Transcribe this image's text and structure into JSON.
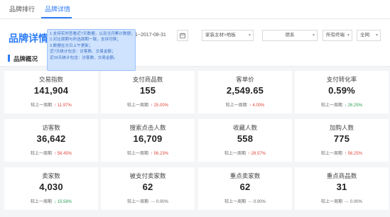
{
  "tabs": [
    {
      "label": "品牌排行"
    },
    {
      "label": "品牌详情"
    }
  ],
  "brand_title": "品牌详情",
  "tooltip_lines": [
    "1.支持实时查看近7天数据，以及当月累计数据；",
    "2.对比周期与所选周期一致，支持切换；",
    "3.数据在次日上午更新；",
    "近7天统计包含：访客数、交易金额；",
    "近30天统计包含：访客数、交易金额。"
  ],
  "filters": {
    "date_range": "1~2017-08-31",
    "category": "家装主材>地板",
    "brand": "德系",
    "terminal": "所有终端",
    "scope": "全网"
  },
  "section_title": "品牌概况",
  "compare_label": "较上一周期",
  "metrics": [
    {
      "label": "交易指数",
      "value": "141,904",
      "dir": "up",
      "change": "11.97%"
    },
    {
      "label": "支付商品数",
      "value": "155",
      "dir": "up",
      "change": "25.00%"
    },
    {
      "label": "客单价",
      "value": "2,549.65",
      "dir": "up",
      "change": "4.00%"
    },
    {
      "label": "支付转化率",
      "value": "0.59%",
      "dir": "down",
      "change": "26.25%"
    },
    {
      "label": "访客数",
      "value": "36,642",
      "dir": "up",
      "change": "58.45%"
    },
    {
      "label": "搜索点击人数",
      "value": "16,709",
      "dir": "up",
      "change": "56.23%"
    },
    {
      "label": "收藏人数",
      "value": "558",
      "dir": "up",
      "change": "28.57%"
    },
    {
      "label": "加购人数",
      "value": "775",
      "dir": "up",
      "change": "56.25%"
    },
    {
      "label": "卖家数",
      "value": "4,030",
      "dir": "down",
      "change": "15.58%"
    },
    {
      "label": "被支付卖家数",
      "value": "62",
      "dir": "flat",
      "change": "0.00%"
    },
    {
      "label": "重点卖家数",
      "value": "62",
      "dir": "flat",
      "change": "0.00%"
    },
    {
      "label": "重点商品数",
      "value": "31",
      "dir": "flat",
      "change": "0.00%"
    }
  ],
  "colors": {
    "accent": "#2f7df6",
    "up": "#e0463a",
    "down": "#2aa155"
  }
}
